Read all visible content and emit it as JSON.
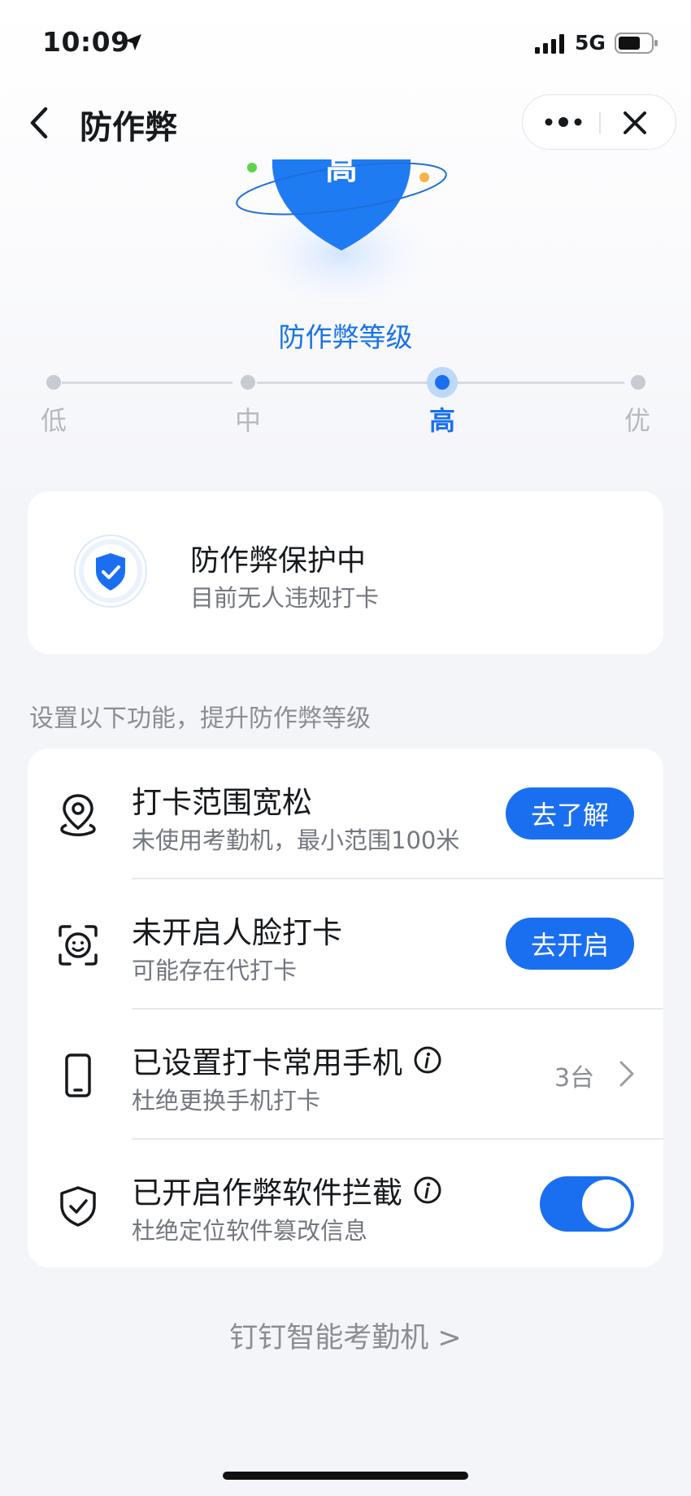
{
  "status_bar": {
    "time": "10:09",
    "network": "5G"
  },
  "nav": {
    "title": "防作弊"
  },
  "hero": {
    "shield_text": "高"
  },
  "level": {
    "title": "防作弊等级",
    "options": [
      "低",
      "中",
      "高",
      "优"
    ],
    "selected": "高"
  },
  "status_card": {
    "title": "防作弊保护中",
    "subtitle": "目前无人违规打卡"
  },
  "section_hint": "设置以下功能，提升防作弊等级",
  "items": [
    {
      "title": "打卡范围宽松",
      "subtitle": "未使用考勤机，最小范围100米",
      "action": "去了解",
      "icon": "location-pin-icon"
    },
    {
      "title": "未开启人脸打卡",
      "subtitle": "可能存在代打卡",
      "action": "去开启",
      "icon": "face-scan-icon"
    },
    {
      "title": "已设置打卡常用手机",
      "subtitle": "杜绝更换手机打卡",
      "count": "3台",
      "icon": "phone-icon"
    },
    {
      "title": "已开启作弊软件拦截",
      "subtitle": "杜绝定位软件篡改信息",
      "toggle": true,
      "icon": "shield-check-icon"
    }
  ],
  "footer_link": "钉钉智能考勤机 >",
  "colors": {
    "accent": "#1a6ff0",
    "accent_text": "#1873e8",
    "background": "#f4f5f9"
  }
}
